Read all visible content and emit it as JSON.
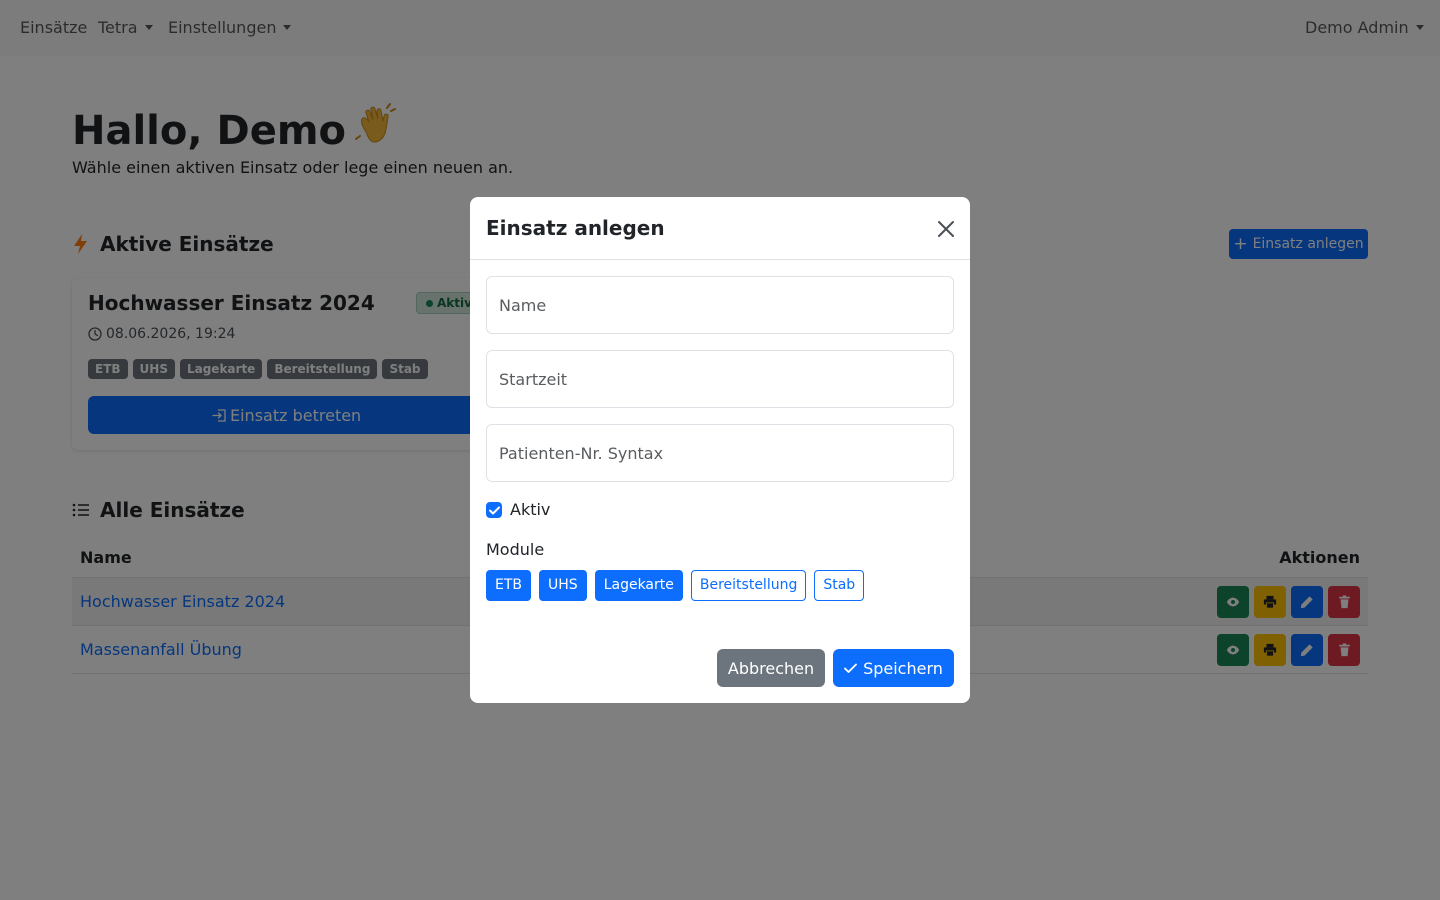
{
  "navbar": {
    "items": [
      {
        "label": "Einsätze"
      },
      {
        "label": "Tetra"
      },
      {
        "label": "Einstellungen"
      }
    ],
    "user": "Demo Admin"
  },
  "header": {
    "greeting": "Hallo, Demo",
    "emoji": "👋",
    "subtitle": "Wähle einen aktiven Einsatz oder lege einen neuen an."
  },
  "active_section": {
    "title": "Aktive Einsätze",
    "new_button": "Einsatz anlegen",
    "card": {
      "title": "Hochwasser Einsatz 2024",
      "status": "Aktiv",
      "time": "08.06.2026, 19:24",
      "modules": [
        "ETB",
        "UHS",
        "Lagekarte",
        "Bereitstellung",
        "Stab"
      ],
      "enter_button": "Einsatz betreten"
    }
  },
  "all_section": {
    "title": "Alle Einsätze",
    "columns": [
      "Name",
      "Aktionen"
    ],
    "rows": [
      {
        "name": "Hochwasser Einsatz 2024"
      },
      {
        "name": "Massenanfall Übung"
      }
    ]
  },
  "modal": {
    "title": "Einsatz anlegen",
    "fields": {
      "name_placeholder": "Name",
      "start_placeholder": "Startzeit",
      "syntax_placeholder": "Patienten-Nr. Syntax"
    },
    "active_label": "Aktiv",
    "active_checked": true,
    "module_label": "Module",
    "modules": [
      {
        "label": "ETB",
        "selected": true
      },
      {
        "label": "UHS",
        "selected": true
      },
      {
        "label": "Lagekarte",
        "selected": true
      },
      {
        "label": "Bereitstellung",
        "selected": false
      },
      {
        "label": "Stab",
        "selected": false
      }
    ],
    "cancel": "Abbrechen",
    "save": "Speichern"
  },
  "colors": {
    "primary": "#0d6efd",
    "secondary": "#6c757d",
    "success": "#198754",
    "warning": "#ffc107",
    "danger": "#dc3545"
  }
}
